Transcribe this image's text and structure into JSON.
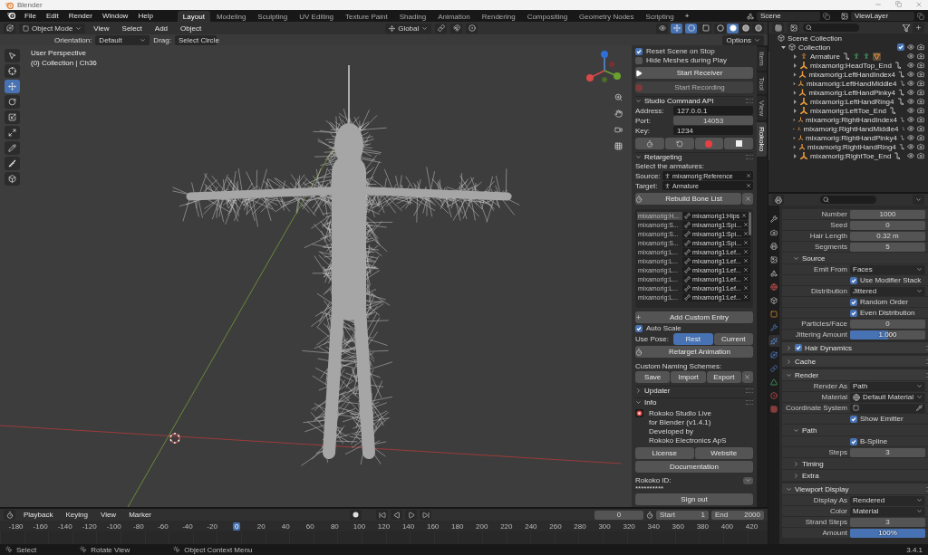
{
  "window": {
    "title": "Blender"
  },
  "menu": [
    "File",
    "Edit",
    "Render",
    "Window",
    "Help"
  ],
  "workspaces": [
    {
      "label": "Layout",
      "selected": true
    },
    {
      "label": "Modeling",
      "selected": false
    },
    {
      "label": "Sculpting",
      "selected": false
    },
    {
      "label": "UV Editing",
      "selected": false
    },
    {
      "label": "Texture Paint",
      "selected": false
    },
    {
      "label": "Shading",
      "selected": false
    },
    {
      "label": "Animation",
      "selected": false
    },
    {
      "label": "Rendering",
      "selected": false
    },
    {
      "label": "Compositing",
      "selected": false
    },
    {
      "label": "Geometry Nodes",
      "selected": false
    },
    {
      "label": "Scripting",
      "selected": false
    }
  ],
  "add_workspace": "+",
  "scene": "Scene",
  "view_layer": "ViewLayer",
  "viewport_header": {
    "mode": "Object Mode",
    "menus": [
      "View",
      "Select",
      "Add",
      "Object"
    ],
    "orientation": "Global",
    "toggles": [
      {
        "kind": "gizmo",
        "on": true
      },
      {
        "kind": "overlays",
        "on": true
      },
      {
        "kind": "xray",
        "on": false
      }
    ],
    "shading": [
      {
        "kind": "wireframe",
        "selected": false
      },
      {
        "kind": "solid",
        "selected": true
      },
      {
        "kind": "material",
        "selected": false
      },
      {
        "kind": "rendered",
        "selected": false
      }
    ]
  },
  "tool_settings": [
    {
      "label": "Orientation:",
      "value": "Default"
    },
    {
      "label": "Drag:",
      "value": "Select Circle"
    }
  ],
  "options": "Options",
  "viewport": {
    "view_name": "User Perspective",
    "collection": "(0) Collection | Ch36",
    "tools": [
      {
        "kind": "select",
        "selected": false
      },
      {
        "kind": "cursor",
        "selected": false
      },
      {
        "kind": "move",
        "selected": true
      },
      {
        "kind": "rotate",
        "selected": false
      },
      {
        "kind": "scale",
        "selected": false
      },
      {
        "kind": "transform",
        "selected": false
      },
      {
        "kind": "annotate",
        "selected": false
      },
      {
        "kind": "measure",
        "selected": false
      },
      {
        "kind": "add-cube",
        "selected": false
      }
    ]
  },
  "sidebar_tabs": [
    {
      "label": "Item",
      "selected": false
    },
    {
      "label": "Tool",
      "selected": false
    },
    {
      "label": "View",
      "selected": false
    },
    {
      "label": "Rokoko",
      "selected": true
    }
  ],
  "rokoko": {
    "options": [
      {
        "label": "Reset Scene on Stop",
        "checked": true
      },
      {
        "label": "Hide Meshes during Play",
        "checked": false
      }
    ],
    "start_receiver": {
      "label": "Start Receiver",
      "disabled": false
    },
    "start_recording": {
      "label": "Start Recording",
      "disabled": true
    },
    "command_api": {
      "title": "Studio Command API",
      "expanded": true,
      "fields": [
        {
          "label": "Address:",
          "value": "127.0.0.1",
          "kind": "text"
        },
        {
          "label": "Port:",
          "value": "14053",
          "kind": "number"
        },
        {
          "label": "Key:",
          "value": "1234",
          "kind": "text"
        }
      ]
    },
    "retargeting": {
      "title": "Retargeting",
      "expanded": true,
      "hint": "Select the armatures:",
      "source": {
        "label": "Source:",
        "value": "mixamorig:Reference"
      },
      "target": {
        "label": "Target:",
        "value": "Armature"
      },
      "rebuild": "Rebuild Bone List",
      "bones": [
        {
          "source": "mixamorig:H...",
          "target": "mixamorig1:Hips",
          "selected": true
        },
        {
          "source": "mixamorig:S...",
          "target": "mixamorig1:Spi...",
          "selected": false
        },
        {
          "source": "mixamorig:S...",
          "target": "mixamorig1:Spi...",
          "selected": false
        },
        {
          "source": "mixamorig:S...",
          "target": "mixamorig1:Spi...",
          "selected": false
        },
        {
          "source": "mixamorig:L...",
          "target": "mixamorig1:Lef...",
          "selected": false
        },
        {
          "source": "mixamorig:L...",
          "target": "mixamorig1:Lef...",
          "selected": false
        },
        {
          "source": "mixamorig:L...",
          "target": "mixamorig1:Lef...",
          "selected": false
        },
        {
          "source": "mixamorig:L...",
          "target": "mixamorig1:Lef...",
          "selected": false
        },
        {
          "source": "mixamorig:L...",
          "target": "mixamorig1:Lef...",
          "selected": false
        },
        {
          "source": "mixamorig:L...",
          "target": "mixamorig1:Lef...",
          "selected": false
        }
      ],
      "add_entry": "Add Custom Entry",
      "auto_scale": {
        "label": "Auto Scale",
        "checked": true
      },
      "use_pose": {
        "label": "Use Pose:",
        "options": [
          {
            "label": "Rest",
            "selected": true
          },
          {
            "label": "Current",
            "selected": false
          }
        ]
      },
      "retarget": "Retarget Animation",
      "naming_label": "Custom Naming Schemes:",
      "naming_buttons": [
        "Save",
        "Import",
        "Export"
      ]
    },
    "updater": {
      "title": "Updater",
      "expanded": false
    },
    "info": {
      "title": "Info",
      "expanded": true,
      "lines": [
        "Rokoko Studio Live",
        "for Blender (v1.4.1)",
        "Developed by",
        "Rokoko Electronics ApS"
      ],
      "links": [
        "License",
        "Website"
      ],
      "documentation": "Documentation"
    },
    "account": {
      "label": "Rokoko ID:",
      "value": "**********",
      "sign_out": "Sign out"
    }
  },
  "outliner": {
    "root": "Scene Collection",
    "collection": {
      "label": "Collection",
      "expanded": true,
      "checked": true,
      "children": [
        {
          "label": "Armature",
          "kind": "armature",
          "expanded": false
        },
        {
          "label": "mixamorig:HeadTop_End",
          "kind": "empty",
          "expanded": false
        },
        {
          "label": "mixamorig:LeftHandIndex4",
          "kind": "empty",
          "expanded": false
        },
        {
          "label": "mixamorig:LeftHandMiddle4",
          "kind": "empty",
          "expanded": false
        },
        {
          "label": "mixamorig:LeftHandPinky4",
          "kind": "empty",
          "expanded": false
        },
        {
          "label": "mixamorig:LeftHandRing4",
          "kind": "empty",
          "expanded": false
        },
        {
          "label": "mixamorig:LeftToe_End",
          "kind": "empty",
          "expanded": false
        },
        {
          "label": "mixamorig:RightHandIndex4",
          "kind": "empty",
          "expanded": false
        },
        {
          "label": "mixamorig:RightHandMiddle4",
          "kind": "empty",
          "expanded": false
        },
        {
          "label": "mixamorig:RightHandPinky4",
          "kind": "empty",
          "expanded": false
        },
        {
          "label": "mixamorig:RightHandRing4",
          "kind": "empty",
          "expanded": false
        },
        {
          "label": "mixamorig:RightToe_End",
          "kind": "empty",
          "expanded": false
        }
      ]
    }
  },
  "properties": {
    "tabs": [
      {
        "kind": "tool",
        "selected": false
      },
      {
        "kind": "render",
        "selected": false
      },
      {
        "kind": "output",
        "selected": false
      },
      {
        "kind": "view_layer",
        "selected": false
      },
      {
        "kind": "scene",
        "selected": false
      },
      {
        "kind": "world",
        "selected": false
      },
      {
        "kind": "collection",
        "selected": false
      },
      {
        "kind": "object",
        "selected": false
      },
      {
        "kind": "modifiers",
        "selected": false
      },
      {
        "kind": "particles",
        "selected": true
      },
      {
        "kind": "physics",
        "selected": false
      },
      {
        "kind": "constraints",
        "selected": false
      },
      {
        "kind": "data",
        "selected": false
      },
      {
        "kind": "material",
        "selected": false
      },
      {
        "kind": "texture",
        "selected": false
      }
    ],
    "rows": [
      {
        "kind": "number",
        "label": "Number",
        "value": "1000"
      },
      {
        "kind": "number",
        "label": "Seed",
        "value": "0"
      },
      {
        "kind": "number",
        "label": "Hair Length",
        "value": "0.32 m"
      },
      {
        "kind": "number",
        "label": "Segments",
        "value": "5"
      },
      {
        "kind": "subpanel",
        "label": "Source",
        "expanded": true
      },
      {
        "kind": "dropdown",
        "label": "Emit From",
        "value": "Faces"
      },
      {
        "kind": "checkbox",
        "label": "Use Modifier Stack",
        "checked": true
      },
      {
        "kind": "dropdown",
        "label": "Distribution",
        "value": "Jittered"
      },
      {
        "kind": "checkbox",
        "label": "Random Order",
        "checked": true
      },
      {
        "kind": "checkbox",
        "label": "Even Distribution",
        "checked": true
      },
      {
        "kind": "number",
        "label": "Particles/Face",
        "value": "0"
      },
      {
        "kind": "slider",
        "label": "Jittering Amount",
        "value": "1.000",
        "level": 0.5
      },
      {
        "kind": "panel",
        "label": "Hair Dynamics",
        "expanded": false,
        "checked": true
      },
      {
        "kind": "panel",
        "label": "Cache",
        "expanded": false
      },
      {
        "kind": "panel",
        "label": "Render",
        "expanded": true
      },
      {
        "kind": "dropdown",
        "label": "Render As",
        "value": "Path"
      },
      {
        "kind": "material",
        "label": "Material",
        "value": "Default Material"
      },
      {
        "kind": "object",
        "label": "Coordinate System"
      },
      {
        "kind": "checkbox",
        "label": "Show Emitter",
        "checked": true
      },
      {
        "kind": "subpanel",
        "label": "Path",
        "expanded": true
      },
      {
        "kind": "checkbox",
        "label": "B-Spline",
        "checked": true
      },
      {
        "kind": "number",
        "label": "Steps",
        "value": "3"
      },
      {
        "kind": "subpanel",
        "label": "Timing",
        "expanded": false
      },
      {
        "kind": "subpanel",
        "label": "Extra",
        "expanded": false
      },
      {
        "kind": "panel",
        "label": "Viewport Display",
        "expanded": true
      },
      {
        "kind": "dropdown",
        "label": "Display As",
        "value": "Rendered"
      },
      {
        "kind": "dropdown",
        "label": "Color",
        "value": "Material"
      },
      {
        "kind": "number",
        "label": "Strand Steps",
        "value": "3"
      },
      {
        "kind": "slider",
        "label": "Amount",
        "value": "100%",
        "level": 1
      }
    ]
  },
  "timeline": {
    "menus": [
      "Playback",
      "Keying",
      "View",
      "Marker"
    ],
    "current_frame": "0",
    "start": {
      "label": "Start",
      "value": "1"
    },
    "end": {
      "label": "End",
      "value": "2000"
    },
    "ruler": [
      {
        "label": "-180",
        "selected": false
      },
      {
        "label": "-160",
        "selected": false
      },
      {
        "label": "-140",
        "selected": false
      },
      {
        "label": "-120",
        "selected": false
      },
      {
        "label": "-100",
        "selected": false
      },
      {
        "label": "-80",
        "selected": false
      },
      {
        "label": "-60",
        "selected": false
      },
      {
        "label": "-40",
        "selected": false
      },
      {
        "label": "-20",
        "selected": false
      },
      {
        "label": "0",
        "selected": true
      },
      {
        "label": "20",
        "selected": false
      },
      {
        "label": "40",
        "selected": false
      },
      {
        "label": "60",
        "selected": false
      },
      {
        "label": "80",
        "selected": false
      },
      {
        "label": "100",
        "selected": false
      },
      {
        "label": "120",
        "selected": false
      },
      {
        "label": "140",
        "selected": false
      },
      {
        "label": "160",
        "selected": false
      },
      {
        "label": "180",
        "selected": false
      },
      {
        "label": "200",
        "selected": false
      },
      {
        "label": "220",
        "selected": false
      },
      {
        "label": "240",
        "selected": false
      },
      {
        "label": "260",
        "selected": false
      },
      {
        "label": "280",
        "selected": false
      },
      {
        "label": "300",
        "selected": false
      },
      {
        "label": "320",
        "selected": false
      },
      {
        "label": "340",
        "selected": false
      },
      {
        "label": "360",
        "selected": false
      },
      {
        "label": "380",
        "selected": false
      },
      {
        "label": "400",
        "selected": false
      },
      {
        "label": "420",
        "selected": false
      }
    ]
  },
  "status_bar": {
    "items": [
      "Select",
      "Rotate View",
      "Object Context Menu"
    ],
    "version": "3.4.1"
  }
}
